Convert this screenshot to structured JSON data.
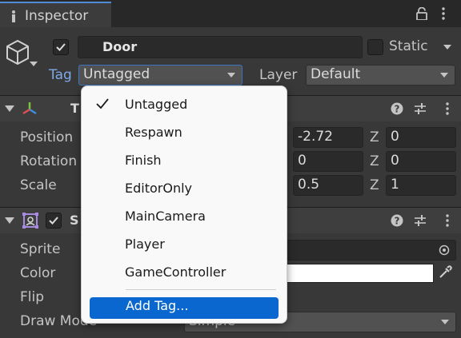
{
  "window": {
    "tab_title": "Inspector"
  },
  "header": {
    "object_name": "Door",
    "static_label": "Static",
    "tag_label": "Tag",
    "tag_value": "Untagged",
    "layer_label": "Layer",
    "layer_value": "Default"
  },
  "transform": {
    "title": "T",
    "position_label": "Position",
    "rotation_label": "Rotation",
    "scale_label": "Scale",
    "position_y": "-2.72",
    "rotation_y": "0",
    "scale_y": "0.5",
    "position_z": "0",
    "rotation_z": "0",
    "scale_z": "1",
    "z_axis": "Z"
  },
  "sprite_renderer": {
    "title": "S",
    "sprite_label": "Sprite",
    "color_label": "Color",
    "flip_label": "Flip",
    "draw_mode_label": "Draw Mode",
    "draw_mode_value": "Simple"
  },
  "tag_menu": {
    "items": [
      "Untagged",
      "Respawn",
      "Finish",
      "EditorOnly",
      "MainCamera",
      "Player",
      "GameController"
    ],
    "checked_index": 0,
    "add_tag": "Add Tag..."
  },
  "colors": {
    "accent": "#0a67d0",
    "tag_label": "#7ea9e6",
    "panel": "#383838"
  }
}
